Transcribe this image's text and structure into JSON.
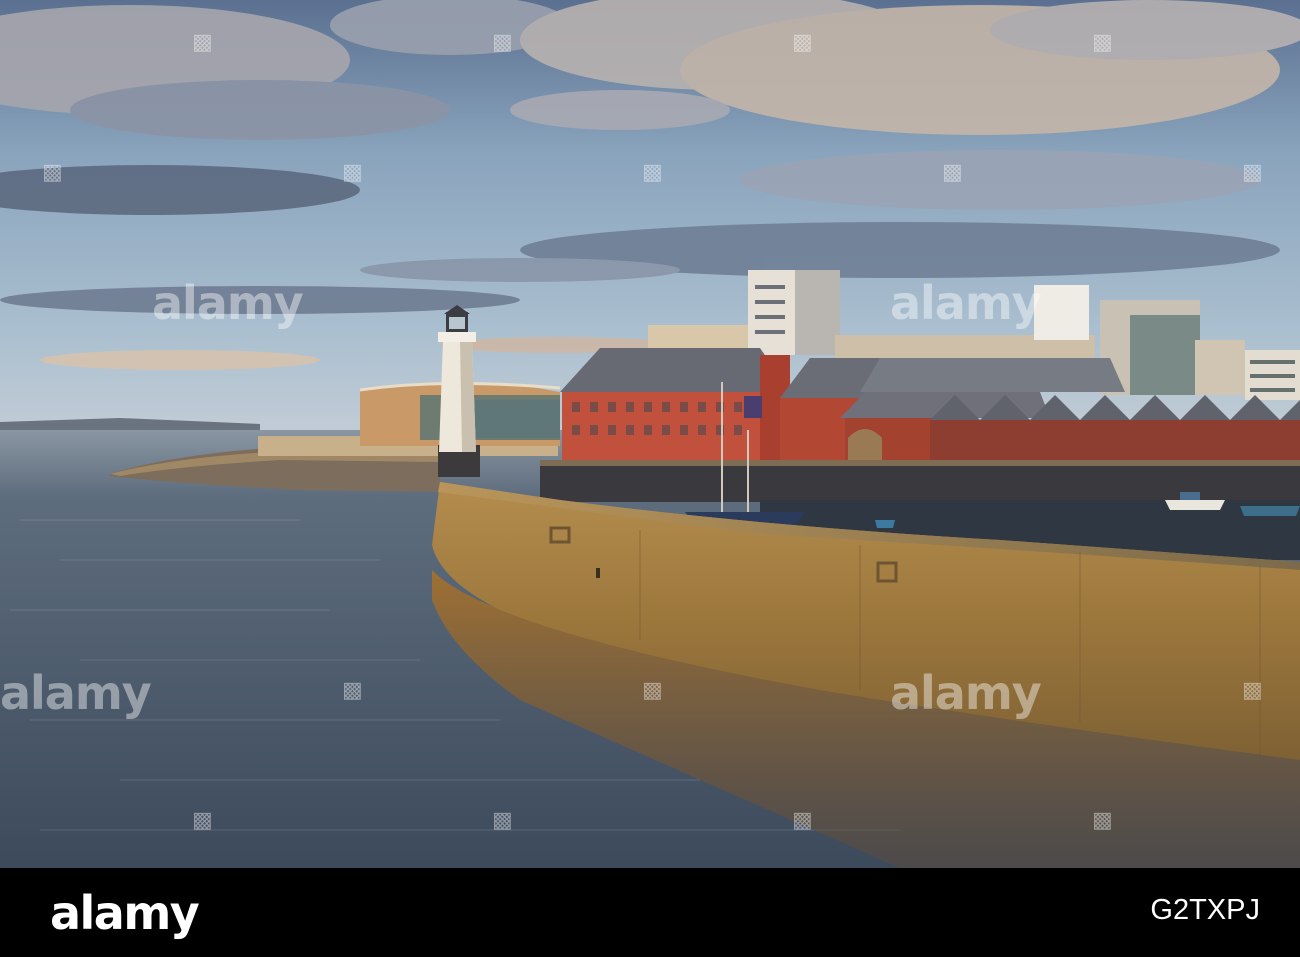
{
  "photo": {
    "colors": {
      "sky_top": "#5f7592",
      "sky_mid": "#9eb7cb",
      "cloud": "#c9b8aa",
      "water": "#4b5b6e",
      "water_reflection": "#9a6a2e",
      "wall": "#a07a3d",
      "warehouse": "#c04e3a",
      "lighthouse": "#efe9de"
    }
  },
  "watermark": {
    "text": "alamy"
  },
  "footer": {
    "logo": "alamy",
    "image_id": "G2TXPJ"
  }
}
